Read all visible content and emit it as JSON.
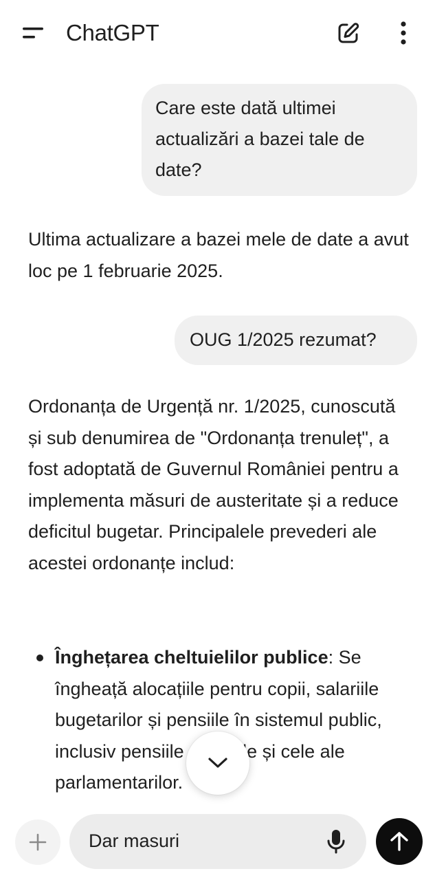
{
  "header": {
    "title": "ChatGPT",
    "menu_icon": "menu-icon",
    "new_chat_icon": "edit-icon",
    "more_icon": "more-vertical-icon"
  },
  "conversation": {
    "user_message_1": "Care este dată ultimei actualizări a bazei tale de date?",
    "assistant_message_1": "Ultima actualizare a bazei mele de date a avut loc pe 1 februarie 2025.",
    "user_message_2": "OUG 1/2025 rezumat?",
    "assistant_message_2": "Ordonanța de Urgență nr. 1/2025, cunoscută și sub denumirea de \"Ordonanța trenuleț\", a fost adoptată de Guvernul României pentru a implementa măsuri de austeritate și a reduce deficitul bugetar. Principalele prevederi ale acestei ordonanțe includ:",
    "bullets": [
      {
        "bold": "Înghețarea cheltuielilor publice",
        "text": ": Se îngheață alocațiile pentru copii, salariile bugetarilor și pensiile în sistemul public, inclusiv pensiile speciale și cele ale parlamentarilor."
      }
    ]
  },
  "scroll_button": {
    "icon": "chevron-down-icon"
  },
  "composer": {
    "input_value": "Dar masuri",
    "add_icon": "plus-icon",
    "mic_icon": "mic-icon",
    "send_icon": "arrow-up-icon"
  },
  "colors": {
    "user_bubble": "#f0f0f0",
    "input_background": "#ececec",
    "send_button": "#0d0d0d",
    "text": "#1f1f1f"
  }
}
